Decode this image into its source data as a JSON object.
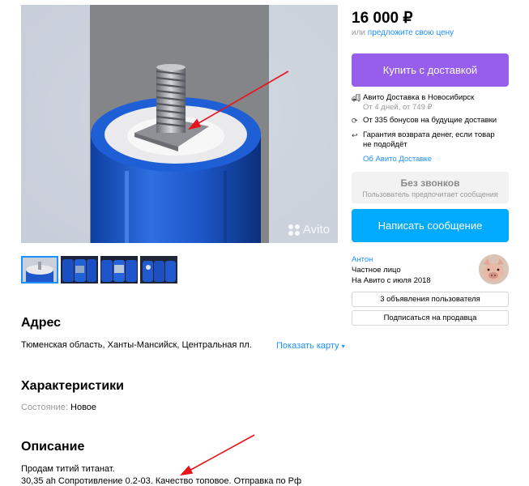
{
  "gallery": {
    "watermark": "Avito",
    "thumb_count": 4
  },
  "address": {
    "heading": "Адрес",
    "value": "Тюменская область, Ханты-Мансийск, Центральная пл.",
    "map_link": "Показать карту"
  },
  "specs": {
    "heading": "Характеристики",
    "condition_label": "Состояние:",
    "condition_value": "Новое"
  },
  "description": {
    "heading": "Описание",
    "line1": "Продам титий титанат.",
    "line2": "30,35 ah Сопротивление 0.2-03. Качество топовое. Отправка по Рф"
  },
  "sidebar": {
    "price": "16 000 ₽",
    "offer_prefix": "или",
    "offer_link": "предложите свою цену",
    "buy_button": "Купить с доставкой",
    "delivery": {
      "line1": "Авито Доставка в Новосибирск",
      "line1_sub": "От 4 дней, от 749 ₽",
      "line2": "От 335 бонусов на будущие доставки",
      "line3": "Гарантия возврата денег, если товар",
      "line3_sub": "не подойдёт",
      "about": "Об Авито Доставке"
    },
    "no_calls": {
      "title": "Без звонков",
      "subtitle": "Пользователь предпочитает сообщения"
    },
    "message_button": "Написать сообщение",
    "seller": {
      "name": "Антон",
      "type": "Частное лицо",
      "since": "На Авито с июля 2018"
    },
    "ads_button": "3 объявления пользователя",
    "subscribe_button": "Подписаться на продавца"
  },
  "colors": {
    "buy": "#965eeb",
    "message": "#00aaff",
    "link": "#1e90ff",
    "annotation": "#e8141b"
  }
}
